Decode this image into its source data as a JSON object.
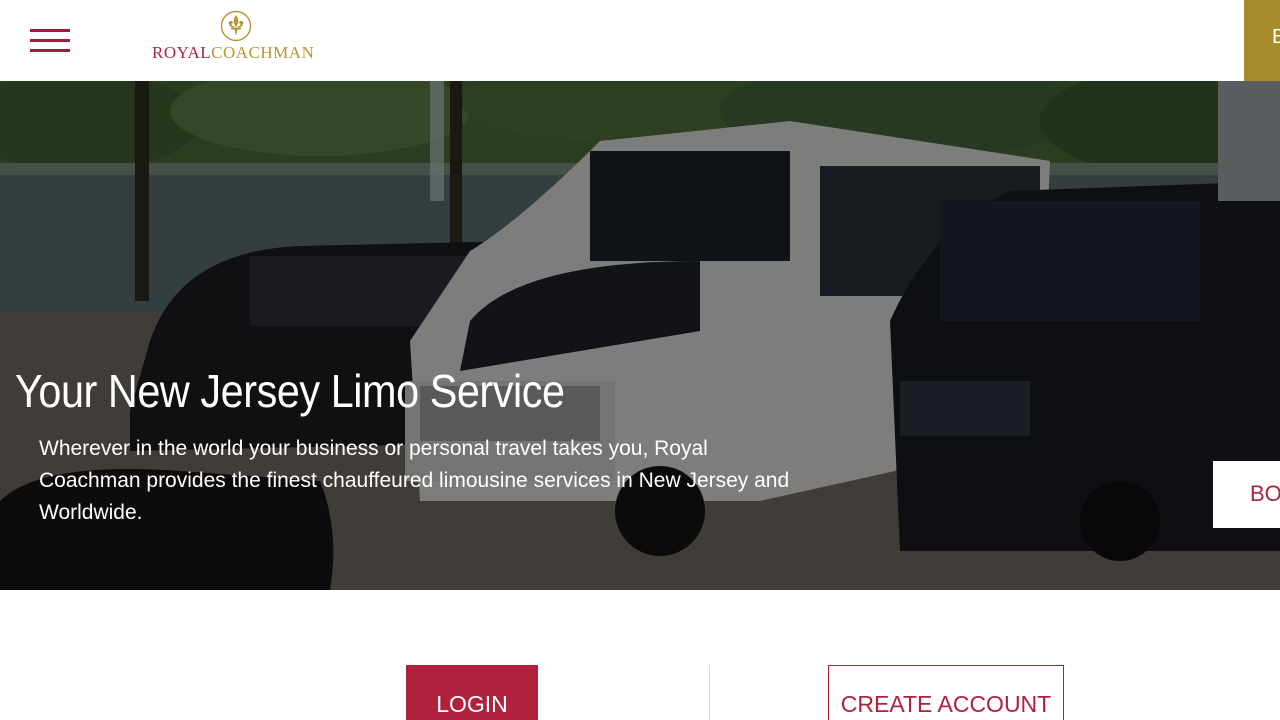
{
  "header": {
    "logo_royal": "ROYAL",
    "logo_coachman": "COACHMAN",
    "cta_partial": "B"
  },
  "hero": {
    "title": "Your New Jersey Limo Service",
    "description": "Wherever in the world your business or personal travel takes you, Royal Coachman provides the finest chauffeured limousine services in New Jersey and Worldwide.",
    "side_tab_partial": "BOO"
  },
  "account": {
    "login_label": "LOGIN",
    "create_account_label": "CREATE ACCOUNT"
  },
  "icons": {
    "menu": "hamburger-menu-icon",
    "logo_emblem": "fleur-de-lis-icon"
  },
  "colors": {
    "brand_red": "#b0213e",
    "brand_gold": "#a78a2a",
    "white": "#ffffff"
  }
}
